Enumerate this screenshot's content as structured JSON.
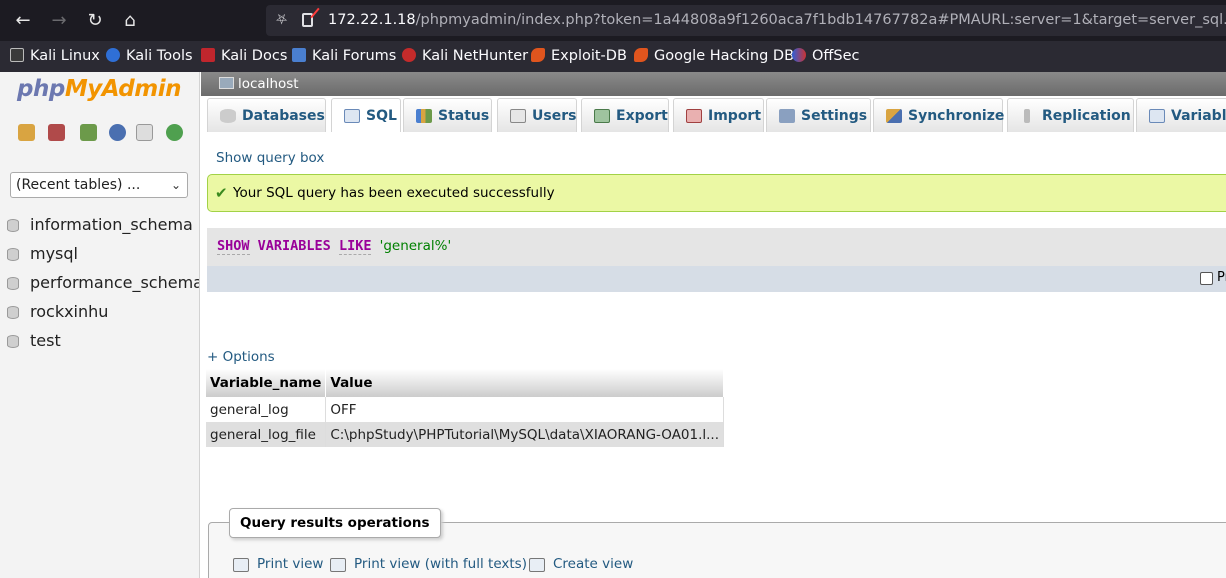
{
  "browser": {
    "url_host": "172.22.1.18",
    "url_rest": "/phpmyadmin/index.php?token=1a44808a9f1260aca7f1bdb14767782a#PMAURL:server=1&target=server_sql.php&to",
    "bookmarks": [
      {
        "label": "Kali Linux"
      },
      {
        "label": "Kali Tools"
      },
      {
        "label": "Kali Docs"
      },
      {
        "label": "Kali Forums"
      },
      {
        "label": "Kali NetHunter"
      },
      {
        "label": "Exploit-DB"
      },
      {
        "label": "Google Hacking DB"
      },
      {
        "label": "OffSec"
      }
    ]
  },
  "sidebar": {
    "logo_php": "php",
    "logo_myadmin": "MyAdmin",
    "recent_tables": "(Recent tables) ...",
    "databases": [
      "information_schema",
      "mysql",
      "performance_schema",
      "rockxinhu",
      "test"
    ]
  },
  "server": {
    "label": "localhost"
  },
  "tabs": [
    {
      "label": "Databases"
    },
    {
      "label": "SQL"
    },
    {
      "label": "Status"
    },
    {
      "label": "Users"
    },
    {
      "label": "Export"
    },
    {
      "label": "Import"
    },
    {
      "label": "Settings"
    },
    {
      "label": "Synchronize"
    },
    {
      "label": "Replication"
    },
    {
      "label": "Variables"
    }
  ],
  "main": {
    "show_query_box": "Show query box",
    "success_message": "Your SQL query has been executed successfully",
    "sql": {
      "kw1": "SHOW",
      "kw2": "VARIABLES",
      "kw3": "LIKE",
      "literal": "'general%'"
    },
    "profiling_label": "Pr",
    "options_link": "+ Options",
    "results": {
      "columns": [
        "Variable_name",
        "Value"
      ],
      "rows": [
        [
          "general_log",
          "OFF"
        ],
        [
          "general_log_file",
          "C:\\phpStudy\\PHPTutorial\\MySQL\\data\\XIAORANG-OA01.l..."
        ]
      ]
    },
    "query_results_operations": {
      "legend": "Query results operations",
      "links": [
        "Print view",
        "Print view (with full texts)",
        "Create view"
      ]
    }
  },
  "colors": {
    "link": "#235a81",
    "success_bg": "#ebf8a4",
    "sql_keyword": "#990099",
    "sql_string": "#008000"
  }
}
